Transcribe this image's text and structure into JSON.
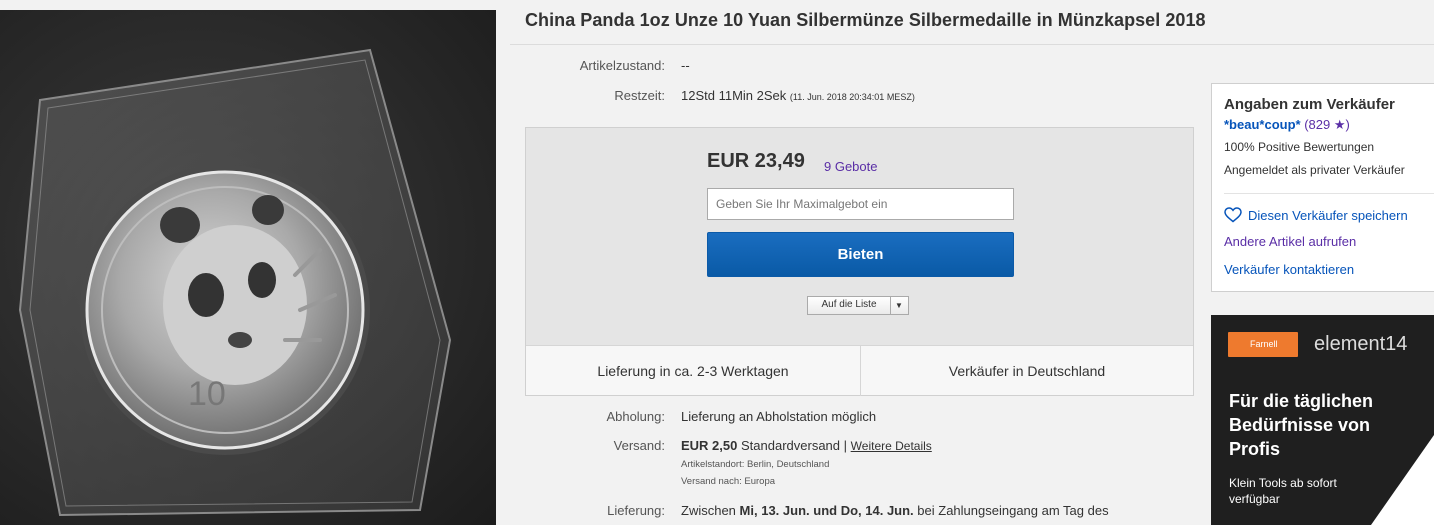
{
  "title": "China Panda 1oz Unze 10 Yuan Silbermünze Silbermedaille in Münzkapsel 2018",
  "photo": {
    "coin_value": "10"
  },
  "condition": {
    "label": "Artikelzustand:",
    "value": "--"
  },
  "time_left": {
    "label": "Restzeit:",
    "value": "12Std 11Min 2Sek",
    "end": "(11. Jun. 2018  20:34:01 MESZ)"
  },
  "bid": {
    "price": "EUR 23,49",
    "bid_count": "9 Gebote",
    "placeholder": "Geben Sie Ihr Maximalgebot ein",
    "button": "Bieten",
    "watch": "Auf die Liste",
    "delivery_info": "Lieferung in ca. 2-3 Werktagen",
    "seller_location": "Verkäufer in Deutschland"
  },
  "pickup": {
    "label": "Abholung:",
    "value": "Lieferung an Abholstation möglich"
  },
  "shipping": {
    "label": "Versand:",
    "price": "EUR 2,50",
    "method": "Standardversand",
    "sep": "|",
    "details_link": "Weitere Details",
    "location": "Artikelstandort: Berlin, Deutschland",
    "ships_to": "Versand nach: Europa"
  },
  "delivery": {
    "label": "Lieferung:",
    "prefix": "Zwischen",
    "date1": "Mi, 13. Jun.",
    "und": "und",
    "date2": "Do, 14. Jun.",
    "suffix": "bei Zahlungseingang am Tag des"
  },
  "seller": {
    "heading": "Angaben zum Verkäufer",
    "name": "*beau*coup*",
    "rating": "(829 ★)",
    "positive": "100% Positive Bewertungen",
    "account": "Angemeldet als privater Verkäufer",
    "save": "Diesen Verkäufer speichern",
    "other_items": "Andere Artikel aufrufen",
    "contact": "Verkäufer kontaktieren"
  },
  "ad": {
    "brand1": "Farnell",
    "brand2": "element14",
    "headline": "Für die täglichen Bedürfnisse von Profis",
    "sub": "Klein Tools ab sofort verfügbar"
  },
  "colors": {
    "link": "#0654ba",
    "visited": "#5a2ea6",
    "bid_button": "#0f62b3",
    "ad_accent": "#ee7a2e"
  }
}
